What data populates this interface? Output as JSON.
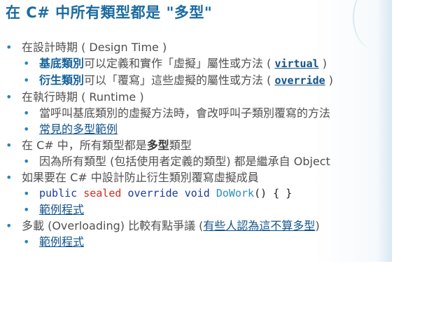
{
  "title": "在 C# 中所有類型都是 \"多型\"",
  "b1": {
    "text": "在設計時期 ( Design Time )",
    "sub1": {
      "bold": "基底類別",
      "mid": "可以定義和實作「虛擬」屬性或方法 ( ",
      "kw": "virtual",
      "end": " )"
    },
    "sub2": {
      "bold": "衍生類別",
      "mid": "可以「覆寫」這些虛擬的屬性或方法 ( ",
      "kw": "override",
      "end": " )"
    }
  },
  "b2": {
    "text": "在執行時期 ( Runtime )",
    "sub1": "當呼叫基底類別的虛擬方法時，會改呼叫子類別覆寫的方法",
    "sub2": "常見的多型範例"
  },
  "b3": {
    "pre": "在 C# 中，所有類型都是",
    "bold": "多型",
    "post": "類型",
    "sub1": "因為所有類型 (包括使用者定義的類型) 都是繼承自 Object"
  },
  "b4": {
    "text": "如果要在 C# 中設計防止衍生類別覆寫虛擬成員",
    "code": {
      "kw1": "public",
      "kw2": "sealed",
      "kw3": "override",
      "kw4": "void",
      "method": "DoWork",
      "rest": "() { }"
    },
    "sub2": "範例程式"
  },
  "b5": {
    "pre": "多載 (Overloading) 比較有點爭議 (",
    "link": "有些人認為這不算多型",
    "post": ")",
    "sub1": "範例程式"
  },
  "icons": {
    "bullet": "•"
  },
  "colors": {
    "title": "#1c6ba0",
    "bullet": "#2a83bf",
    "link": "#11538a",
    "code_keyword": "#1a3aa0",
    "code_sealed": "#d12b1d",
    "code_method": "#2a8fb8"
  }
}
